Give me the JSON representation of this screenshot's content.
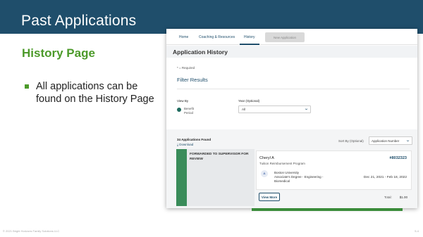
{
  "slide": {
    "title": "Past Applications",
    "section_heading": "History Page",
    "bullets": [
      "All applications can be found on the History Page"
    ],
    "footer_copyright": "© 2021 Bright Horizons Family Solutions LLC",
    "page_number": "5-4"
  },
  "app": {
    "nav": {
      "home": "Home",
      "coaching": "Coaching & Resources",
      "history": "History",
      "new_application": "New Application"
    },
    "page_heading": "Application History",
    "required_note": "* = Required",
    "filter_title": "Filter Results",
    "view_by_label": "View By",
    "radio_option": "Benefit Period",
    "year_label": "Year (Optional)",
    "year_value": "All",
    "found_count": "34 Applications Found",
    "download": "Download",
    "sort_label": "Sort By (Optional)",
    "sort_value": "Application Number",
    "result": {
      "status": "FORWARDED TO SUPERVISOR FOR REVIEW",
      "applicant": "Cheryl A",
      "program": "Tuition Reimbursement Program",
      "number": "#8032323",
      "school": "Boston University",
      "degree": "Associate's Degree - Engineering - Biomedical",
      "dates": "Dec 21, 2021 - Feb 18, 2022",
      "view_more": "View More",
      "total_label": "Total:",
      "total_value": "$1.00"
    }
  },
  "colors": {
    "header": "#1f4e6b",
    "accent_green": "#4c9a2a",
    "status_green": "#3a8c5a",
    "link_blue": "#1f4e6b"
  }
}
